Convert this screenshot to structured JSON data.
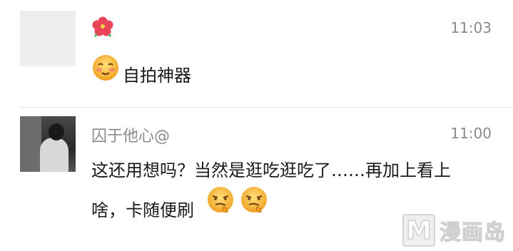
{
  "messages": [
    {
      "sender": "",
      "time": "11:03",
      "avatar": "blank",
      "sender_icon": "hibiscus-flower-icon",
      "emoji": "blush-emoji",
      "text": "自拍神器"
    },
    {
      "sender": "囚于他心@",
      "time": "11:00",
      "avatar": "photo-of-girl",
      "line1": "这还用想吗？当然是逛吃逛吃了……再加上看上",
      "line2": "啥，卡随便刷",
      "emojis": [
        "sly-smirk-emoji",
        "sly-smirk-emoji"
      ]
    }
  ],
  "watermark": {
    "badge": "M",
    "text": "漫画岛"
  },
  "colors": {
    "name": "#8a8a8a",
    "time": "#8a8a8a",
    "text": "#1a1a1a",
    "divider": "#e2e2e2",
    "emoji_face": "#f7b733"
  }
}
